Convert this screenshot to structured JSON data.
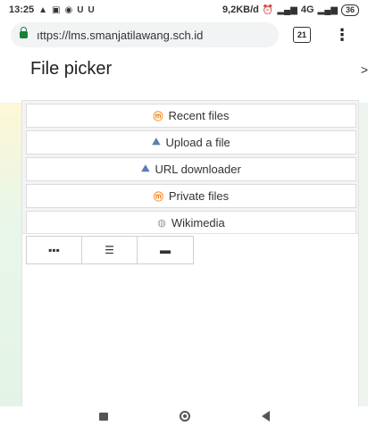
{
  "status_bar": {
    "time": "13:25",
    "left_icons": [
      "warning-icon",
      "gallery-icon",
      "message-icon",
      "u-icon",
      "u-icon"
    ],
    "net_speed": "9,2KB/d",
    "network": "4G",
    "battery": "36"
  },
  "browser": {
    "url": "ıttps://lms.smanjatilawang.sch.id",
    "tab_count": "21"
  },
  "file_picker": {
    "title": "File picker",
    "close_label": ">",
    "repositories": [
      {
        "label": "Recent files",
        "icon": "moodle-icon"
      },
      {
        "label": "Upload a file",
        "icon": "upload-icon"
      },
      {
        "label": "URL downloader",
        "icon": "url-icon"
      },
      {
        "label": "Private files",
        "icon": "moodle-icon"
      },
      {
        "label": "Wikimedia",
        "icon": "wikimedia-icon"
      }
    ],
    "view_buttons": [
      "grid-view-icon",
      "list-view-icon",
      "folder-view-icon"
    ]
  },
  "colors": {
    "moodle_orange": "#f98012",
    "lock_green": "#1a7f37"
  }
}
